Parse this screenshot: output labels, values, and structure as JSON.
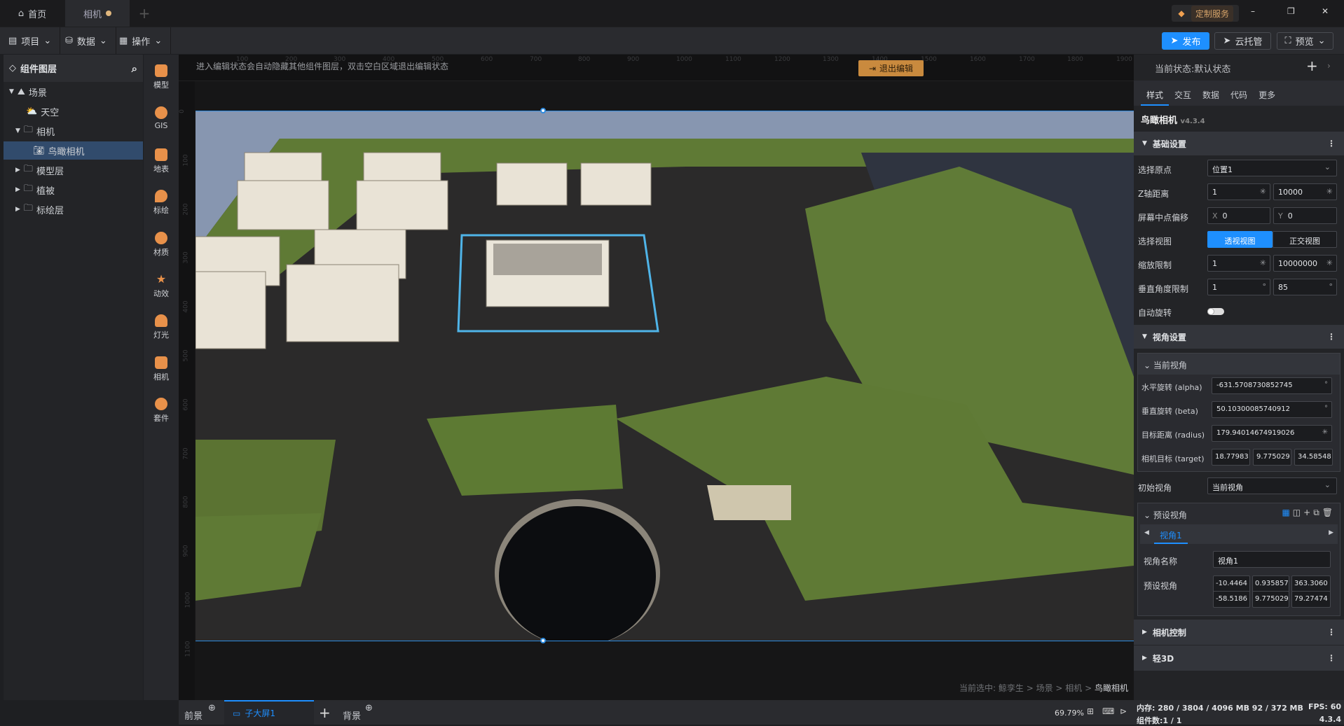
{
  "titlebar": {
    "tabs": [
      {
        "label": "首页",
        "icon": "home-icon"
      },
      {
        "label": "相机",
        "modified": true
      }
    ],
    "new_tab": "+",
    "custom_service": "定制服务",
    "window": {
      "minimize": "–",
      "restore": "❐",
      "close": "✕"
    }
  },
  "toolbar": {
    "menus": [
      {
        "label": "项目",
        "icon": "file-icon"
      },
      {
        "label": "数据",
        "icon": "database-icon"
      },
      {
        "label": "操作",
        "icon": "grid-icon"
      }
    ],
    "publish": "发布",
    "cloud": "云托管",
    "preview": "预览"
  },
  "layers": {
    "title": "组件图层",
    "items": [
      {
        "label": "场景",
        "icon": "scene-icon",
        "expanded": true
      },
      {
        "label": "天空",
        "icon": "sky-icon"
      },
      {
        "label": "相机",
        "icon": "folder-icon",
        "expanded": true
      },
      {
        "label": "鸟瞰相机",
        "icon": "camera-icon",
        "selected": true
      },
      {
        "label": "模型层",
        "icon": "folder-icon"
      },
      {
        "label": "植被",
        "icon": "folder-icon"
      },
      {
        "label": "标绘层",
        "icon": "folder-icon"
      }
    ]
  },
  "iconstrip": [
    "模型",
    "GIS",
    "地表",
    "标绘",
    "材质",
    "动效",
    "灯光",
    "相机",
    "套件"
  ],
  "canvas": {
    "hint": "进入编辑状态会自动隐藏其他组件图层，双击空白区域退出编辑状态",
    "exit_edit": "退出编辑",
    "ruler_top": [
      "100",
      "200",
      "300",
      "400",
      "500",
      "600",
      "700",
      "800",
      "900",
      "1000",
      "1100",
      "1200",
      "1300",
      "1400",
      "1500",
      "1600",
      "1700",
      "1800",
      "1900"
    ],
    "ruler_left": [
      "0",
      "100",
      "200",
      "300",
      "400",
      "500",
      "600",
      "700",
      "800",
      "900",
      "1000",
      "1100"
    ],
    "breadcrumb_prefix": "当前选中:",
    "breadcrumb": [
      "鲸孪生",
      "场景",
      "相机"
    ],
    "breadcrumb_current": "鸟瞰相机"
  },
  "bottombar": {
    "foreground": "前景",
    "screen_tab": "子大屏1",
    "add": "+",
    "background": "背景",
    "zoom": "69.79%"
  },
  "right": {
    "state_label": "当前状态:",
    "state_value": "默认状态",
    "tabs": [
      "样式",
      "交互",
      "数据",
      "代码",
      "更多"
    ],
    "active_tab": 0,
    "component": "鸟瞰相机",
    "version": "v4.3.4",
    "basic": {
      "title": "基础设置",
      "origin_label": "选择原点",
      "origin": "位置1",
      "z_label": "Z轴距离",
      "z_min": "1",
      "z_max": "10000",
      "offset_label": "屏幕中点偏移",
      "offset_x": "0",
      "offset_y": "0",
      "x": "X",
      "y": "Y",
      "view_label": "选择视图",
      "view_options": [
        "透视视图",
        "正交视图"
      ],
      "zoom_label": "缩放限制",
      "zoom_min": "1",
      "zoom_max": "10000000",
      "vangle_label": "垂直角度限制",
      "vangle_min": "1",
      "vangle_max": "85",
      "autorotate_label": "自动旋转",
      "autorotate": false
    },
    "view": {
      "title": "视角设置",
      "current_title": "当前视角",
      "alpha_label": "水平旋转 (alpha)",
      "alpha": "-631.5708730852745",
      "beta_label": "垂直旋转 (beta)",
      "beta": "50.10300085740912",
      "radius_label": "目标距离 (radius)",
      "radius": "179.94014674919026",
      "target_label": "相机目标 (target)",
      "target": [
        "18.77983",
        "9.775029",
        "34.58548"
      ],
      "initial_label": "初始视角",
      "initial": "当前视角",
      "preset_title": "预设视角",
      "preset_tab": "视角1",
      "name_label": "视角名称",
      "name": "视角1",
      "preset_label": "预设视角",
      "preset_values": [
        "-10.4464",
        "0.935857",
        "363.3060",
        "-58.5186",
        "9.775029",
        "79.27474"
      ]
    },
    "camera_control": "相机控制",
    "light3d": "轻3D"
  },
  "status": {
    "memory_label": "内存:",
    "memory": "280 / 3804 / 4096 MB  92 / 372 MB",
    "fps_label": "FPS:",
    "fps": "60",
    "count_label": "组件数:",
    "count": "1 / 1",
    "version": "4.3.4"
  },
  "colors": {
    "accent": "#1e8fff",
    "orange": "#c98a3e",
    "sky": "#8796b0",
    "grass": "#5f7a35",
    "road": "#2b2a2a"
  }
}
